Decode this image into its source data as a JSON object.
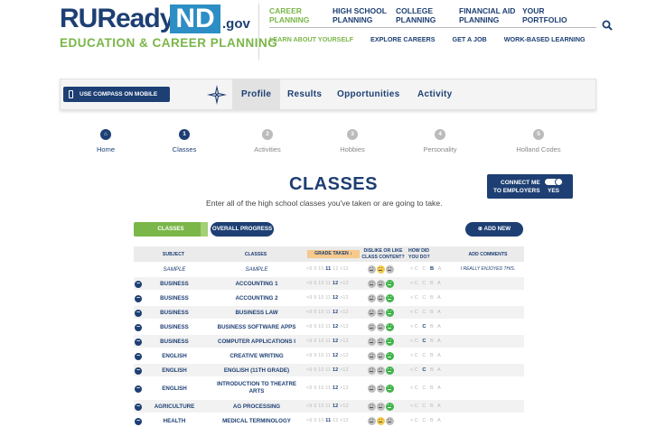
{
  "logo": {
    "main": "RUReady.",
    "nd": "ND",
    "gov": ".gov",
    "sub": "EDUCATION & CAREER PLANNING"
  },
  "topnav": [
    {
      "label": "CAREER PLANNING",
      "active": true
    },
    {
      "label": "HIGH SCHOOL PLANNING",
      "active": false
    },
    {
      "label": "COLLEGE PLANNING",
      "active": false
    },
    {
      "label": "FINANCIAL AID PLANNING",
      "active": false
    },
    {
      "label": "YOUR PORTFOLIO",
      "active": false
    }
  ],
  "subnav": [
    {
      "label": "LEARN ABOUT YOURSELF",
      "active": true
    },
    {
      "label": "EXPLORE CAREERS",
      "active": false
    },
    {
      "label": "GET A JOB",
      "active": false
    },
    {
      "label": "WORK-BASED LEARNING",
      "active": false
    }
  ],
  "toolbar": {
    "mobile_label": "USE COMPASS ON MOBILE",
    "tabs": [
      "Profile",
      "Results",
      "Opportunities",
      "Activity"
    ]
  },
  "steps": [
    {
      "label": "Home",
      "glyph": "⌂"
    },
    {
      "label": "Classes",
      "glyph": "1"
    },
    {
      "label": "Activities",
      "glyph": "2"
    },
    {
      "label": "Hobbies",
      "glyph": "3"
    },
    {
      "label": "Personality",
      "glyph": "4"
    },
    {
      "label": "Holland Codes",
      "glyph": "5"
    }
  ],
  "page": {
    "title": "CLASSES",
    "subtitle": "Enter all of the high school classes you've taken or are going to take.",
    "connect_line1": "CONNECT ME",
    "connect_line2": "TO EMPLOYERS",
    "connect_toggle": "YES",
    "classes_tab": "CLASSES",
    "progress_tab": "OVERALL PROGRESS",
    "add_new": "⊕ ADD NEW"
  },
  "table": {
    "headers": {
      "subject": "SUBJECT",
      "classes": "CLASSES",
      "grade": "GRADE TAKEN ↓",
      "like1": "DISLIKE OR LIKE",
      "like2": "CLASS CONTENT?",
      "how1": "HOW DID",
      "how2": "YOU DO?",
      "comments": "ADD COMMENTS"
    },
    "grade_options": [
      "<9",
      "9",
      "10",
      "11",
      "12",
      ">12"
    ],
    "mark_options": [
      "<C",
      "C",
      "B",
      "A"
    ],
    "rows": [
      {
        "subject": "SAMPLE",
        "class": "SAMPLE",
        "grade": "11",
        "face": "meh",
        "mark": "B",
        "comment": "I REALLY ENJOYED THIS.",
        "sample": true
      },
      {
        "subject": "BUSINESS",
        "class": "ACCOUNTING 1",
        "grade": "12",
        "face": "happy",
        "mark": "",
        "comment": ""
      },
      {
        "subject": "BUSINESS",
        "class": "ACCOUNTING 2",
        "grade": "12",
        "face": "happy",
        "mark": "",
        "comment": ""
      },
      {
        "subject": "BUSINESS",
        "class": "BUSINESS LAW",
        "grade": "12",
        "face": "happy",
        "mark": "",
        "comment": ""
      },
      {
        "subject": "BUSINESS",
        "class": "BUSINESS SOFTWARE APPS",
        "grade": "12",
        "face": "happy",
        "mark": "C",
        "comment": ""
      },
      {
        "subject": "BUSINESS",
        "class": "COMPUTER APPLICATIONS I",
        "grade": "12",
        "face": "happy",
        "mark": "C",
        "comment": ""
      },
      {
        "subject": "ENGLISH",
        "class": "CREATIVE WRITING",
        "grade": "12",
        "face": "happy",
        "mark": "",
        "comment": ""
      },
      {
        "subject": "ENGLISH",
        "class": "ENGLISH (11TH GRADE)",
        "grade": "12",
        "face": "happy",
        "mark": "C",
        "comment": ""
      },
      {
        "subject": "ENGLISH",
        "class": "INTRODUCTION TO THEATRE ARTS",
        "grade": "12",
        "face": "happy",
        "mark": "",
        "comment": ""
      },
      {
        "subject": "AGRICULTURE",
        "class": "AG PROCESSING",
        "grade": "12",
        "face": "happy",
        "mark": "",
        "comment": ""
      },
      {
        "subject": "HEALTH",
        "class": "MEDICAL TERMINOLOGY",
        "grade": "11",
        "face": "meh",
        "mark": "",
        "comment": ""
      }
    ]
  },
  "colors": {
    "navy": "#1d3f73",
    "green": "#7ab648",
    "blue": "#2c8ec4"
  }
}
